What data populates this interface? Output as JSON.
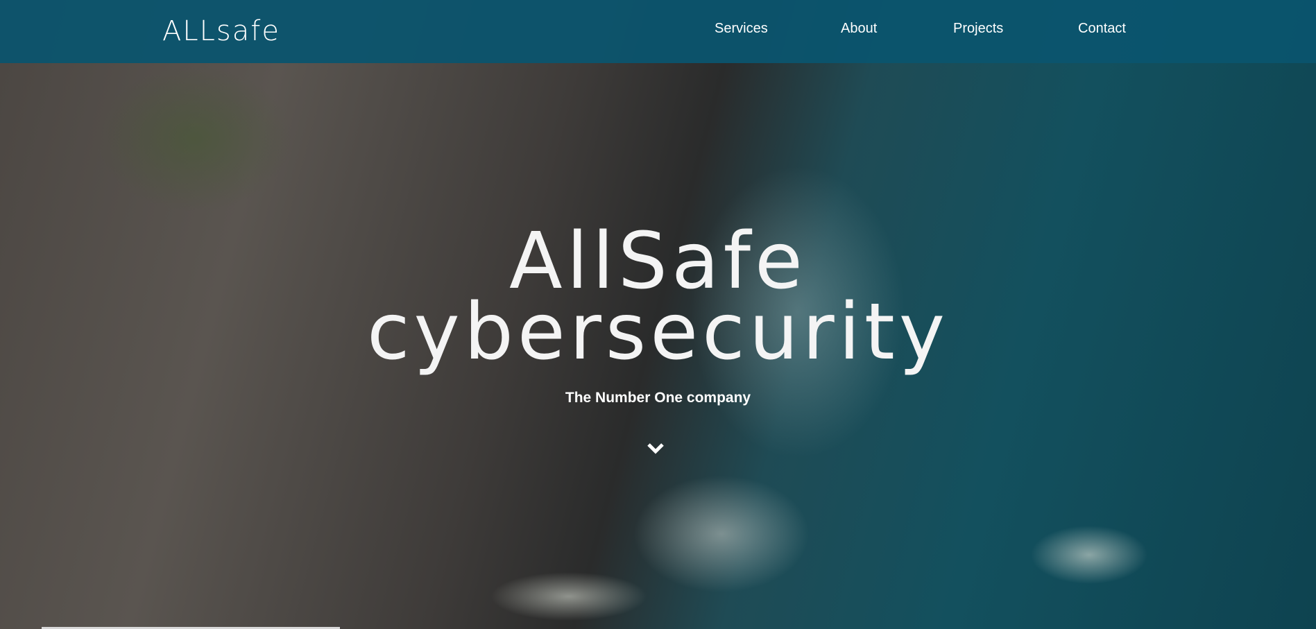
{
  "header": {
    "logo": "ALLsafe",
    "nav": [
      "Services",
      "About",
      "Projects",
      "Contact"
    ]
  },
  "hero": {
    "title_line1": "AllSafe",
    "title_line2": "cybersecurity",
    "subtitle": "The Number One company",
    "scroll_icon": "chevron-down-icon"
  },
  "video": {
    "progress_percent": 23
  },
  "colors": {
    "header": "#0b546e",
    "text": "#ffffff"
  }
}
